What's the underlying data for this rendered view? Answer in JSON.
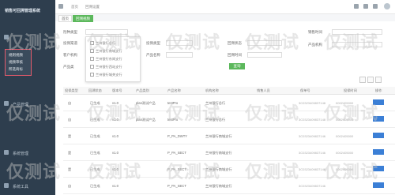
{
  "app": {
    "title": "销售可回溯管理系统"
  },
  "sidebar": {
    "popup_items": [
      "规则视频",
      "视频审核",
      "所选商标"
    ],
    "items": [
      {
        "label": "产品管理",
        "icon": "box-icon"
      },
      {
        "label": "系统管理",
        "icon": "gear-icon"
      },
      {
        "label": "系统工具",
        "icon": "tool-icon"
      }
    ]
  },
  "header": {
    "crumbs": [
      "首页",
      "回溯设置"
    ]
  },
  "tabs": [
    {
      "label": "首页",
      "active": false
    },
    {
      "label": "回溯视频",
      "active": true
    }
  ],
  "form": {
    "labels": {
      "l1": "险种类型",
      "l2": "投保渠道",
      "l3": "客户机构",
      "l4": "产品类",
      "l5": "投保类型",
      "l6": "产品名称",
      "l7": "回溯状态",
      "l8": "回溯时间",
      "l9": "销售时间",
      "l10": "产品机构"
    },
    "search_label": "查询"
  },
  "dropdown": {
    "items": [
      "兰州银行总行",
      "兰州银行南城支行",
      "兰州银行东岗支行",
      "兰州银行西站支行",
      "兰州银行城关支行"
    ]
  },
  "table": {
    "headers": [
      "投保类型",
      "回溯状态",
      "版本号",
      "产品类别",
      "产品名称",
      "机构名称",
      "销售人员",
      "保单号",
      "投保时间",
      "操作"
    ],
    "rows": [
      {
        "c1": "自",
        "status": "已生成",
        "ver": "v1.0",
        "cat": "plan测试产品",
        "name": "testPro",
        "org": "兰州银行总行",
        "policy": "3C0323409837148",
        "time": "2018-06-23",
        "acct": "0002405000"
      },
      {
        "c1": "自",
        "status": "已生成",
        "ver": "v1.0",
        "cat": "plan测试产品",
        "name": "testPro",
        "org": "兰州银行总行",
        "policy": "3C0323409837148",
        "time": "2018-06-23",
        "acct": "0002405000"
      },
      {
        "c1": "是",
        "status": "已生成",
        "ver": "v1.0",
        "cat": "",
        "name": "P_PA_DWTY",
        "org": "兰州银行南城支行",
        "policy": "3C0323409837146",
        "time": "2018-06-23",
        "acct": "0002405000"
      },
      {
        "c1": "是",
        "status": "已生成",
        "ver": "v1.0",
        "cat": "",
        "name": "P_PA_SECT",
        "org": "兰州银行南城支行",
        "policy": "3C0323409837146",
        "time": "2018-06-23",
        "acct": "0002405000"
      },
      {
        "c1": "是",
        "status": "已生成",
        "ver": "v1.0",
        "cat": "",
        "name": "P_PA_SECT",
        "org": "兰州银行南城支行",
        "policy": "3C0323409837146",
        "time": "2018-06-23",
        "acct": "0002405000"
      },
      {
        "c1": "自",
        "status": "已生成",
        "ver": "v1.0",
        "cat": "",
        "name": "P_PA_SECT",
        "org": "兰州银行南城支行",
        "policy": "3C0323409837146",
        "time": "2018-06-23",
        "acct": "0002405000"
      }
    ]
  },
  "watermark": "仅测试"
}
